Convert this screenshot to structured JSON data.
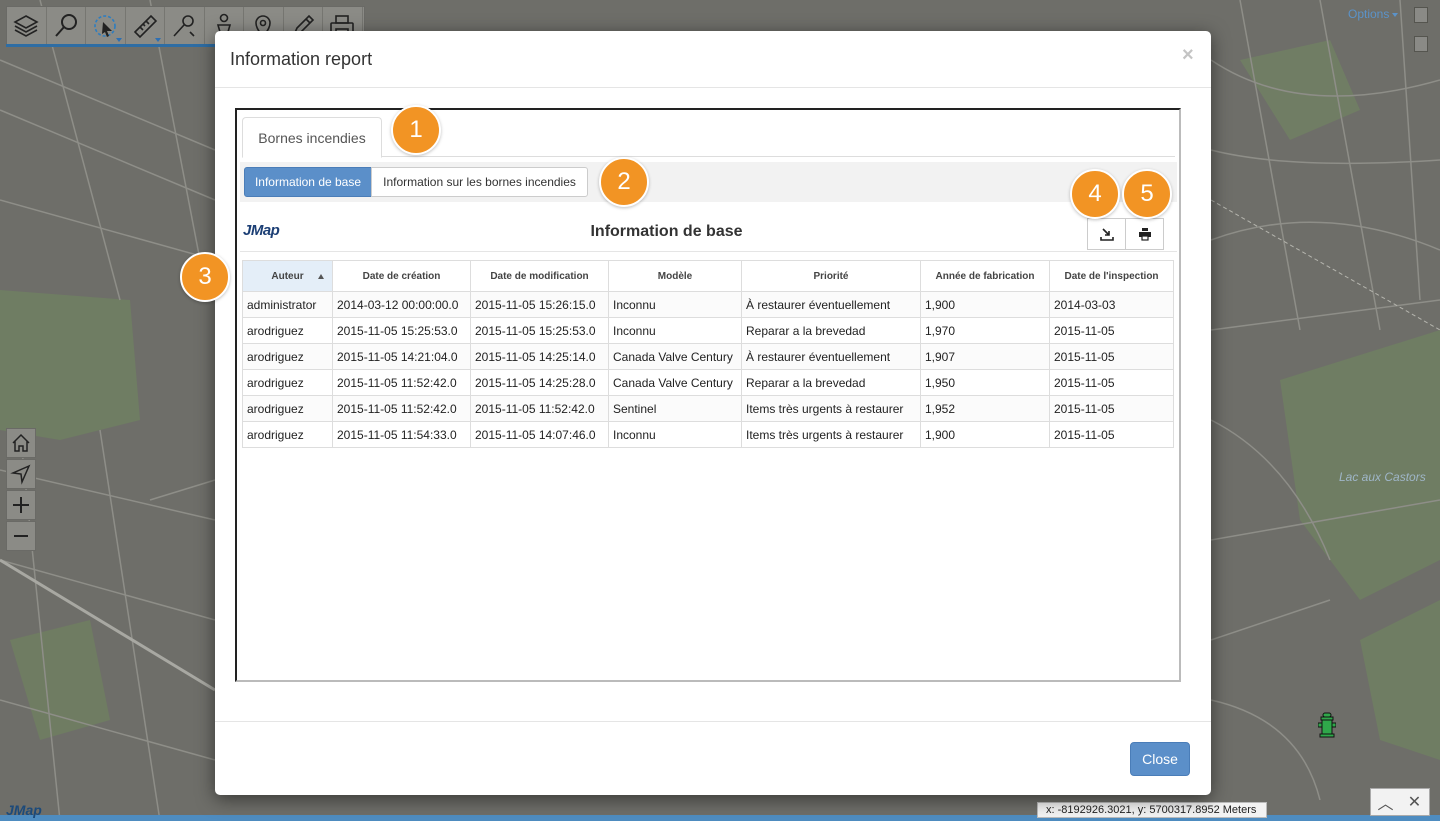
{
  "colors": {
    "accent": "#5b8fc9",
    "callout": "#f29424",
    "map": "#6f6f6a"
  },
  "toolbar": {
    "tools": [
      {
        "name": "layers-icon"
      },
      {
        "name": "search-icon"
      },
      {
        "name": "select-icon"
      },
      {
        "name": "measure-icon"
      },
      {
        "name": "pin-icon"
      },
      {
        "name": "person-icon"
      },
      {
        "name": "location-icon"
      },
      {
        "name": "edit-icon"
      },
      {
        "name": "print-icon"
      }
    ],
    "options_label": "Options"
  },
  "map": {
    "lake_label": "Lac aux Castors",
    "logo": "JMap",
    "coordinates": "x: -8192926.3021, y: 5700317.8952 Meters"
  },
  "modal": {
    "title": "Information report",
    "close_symbol": "×",
    "tab_label": "Bornes incendies",
    "sub_tabs": [
      "Information de base",
      "Information sur les bornes incendies"
    ],
    "report_logo": "JMap",
    "report_title": "Information de base",
    "close_button": "Close"
  },
  "table": {
    "columns": [
      "Auteur",
      "Date de création",
      "Date de modification",
      "Modèle",
      "Priorité",
      "Année de fabrication",
      "Date de l'inspection"
    ],
    "rows": [
      [
        "administrator",
        "2014-03-12 00:00:00.0",
        "2015-11-05 15:26:15.0",
        "Inconnu",
        "À restaurer éventuellement",
        "1,900",
        "2014-03-03"
      ],
      [
        "arodriguez",
        "2015-11-05 15:25:53.0",
        "2015-11-05 15:25:53.0",
        "Inconnu",
        "Reparar a la brevedad",
        "1,970",
        "2015-11-05"
      ],
      [
        "arodriguez",
        "2015-11-05 14:21:04.0",
        "2015-11-05 14:25:14.0",
        "Canada Valve Century",
        "À restaurer éventuellement",
        "1,907",
        "2015-11-05"
      ],
      [
        "arodriguez",
        "2015-11-05 11:52:42.0",
        "2015-11-05 14:25:28.0",
        "Canada Valve Century",
        "Reparar a la brevedad",
        "1,950",
        "2015-11-05"
      ],
      [
        "arodriguez",
        "2015-11-05 11:52:42.0",
        "2015-11-05 11:52:42.0",
        "Sentinel",
        "Items très urgents à restaurer",
        "1,952",
        "2015-11-05"
      ],
      [
        "arodriguez",
        "2015-11-05 11:54:33.0",
        "2015-11-05 14:07:46.0",
        "Inconnu",
        "Items très urgents à restaurer",
        "1,900",
        "2015-11-05"
      ]
    ]
  },
  "callouts": [
    "1",
    "2",
    "3",
    "4",
    "5"
  ]
}
